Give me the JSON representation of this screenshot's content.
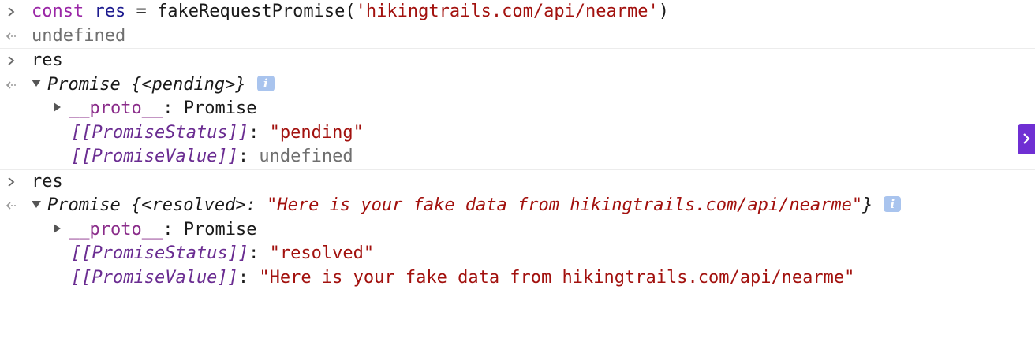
{
  "entries": [
    {
      "input": {
        "keyword": "const",
        "variable": "res",
        "operator": "=",
        "call": "fakeRequestPromise(",
        "argument": "'hikingtrails.com/api/nearme'",
        "close": ")"
      },
      "output": "undefined"
    },
    {
      "input": {
        "expression": "res"
      },
      "output": {
        "type": "Promise",
        "summary": "{<pending>}",
        "info": "i",
        "proto_key": "__proto__",
        "proto_value": "Promise",
        "status_key": "[[PromiseStatus]]",
        "status_value": "\"pending\"",
        "value_key": "[[PromiseValue]]",
        "value_value": "undefined"
      }
    },
    {
      "input": {
        "expression": "res"
      },
      "output": {
        "type": "Promise",
        "summary_open": "{<resolved>: ",
        "summary_value": "\"Here is your fake data from hikingtrails.com/api/nearme\"",
        "summary_close": "}",
        "info": "i",
        "proto_key": "__proto__",
        "proto_value": "Promise",
        "status_key": "[[PromiseStatus]]",
        "status_value": "\"resolved\"",
        "value_key": "[[PromiseValue]]",
        "value_value": "\"Here is your fake data from hikingtrails.com/api/nearme\""
      }
    }
  ],
  "colon": ": ",
  "colors": {
    "keyword": "#9a26a6",
    "variable": "#1d1b8f",
    "string": "#a2110e",
    "muted": "#6f6f6f",
    "internal_property": "#6a2c91",
    "side_tab": "#6f2fd3",
    "info_badge": "#a9c4ee"
  },
  "icons": {
    "input_prompt": "chevron-right-icon",
    "output_prompt": "return-arrow-icon",
    "expand": "triangle-down-icon",
    "collapse": "triangle-right-icon",
    "side_tab": "chevron-right-icon"
  }
}
